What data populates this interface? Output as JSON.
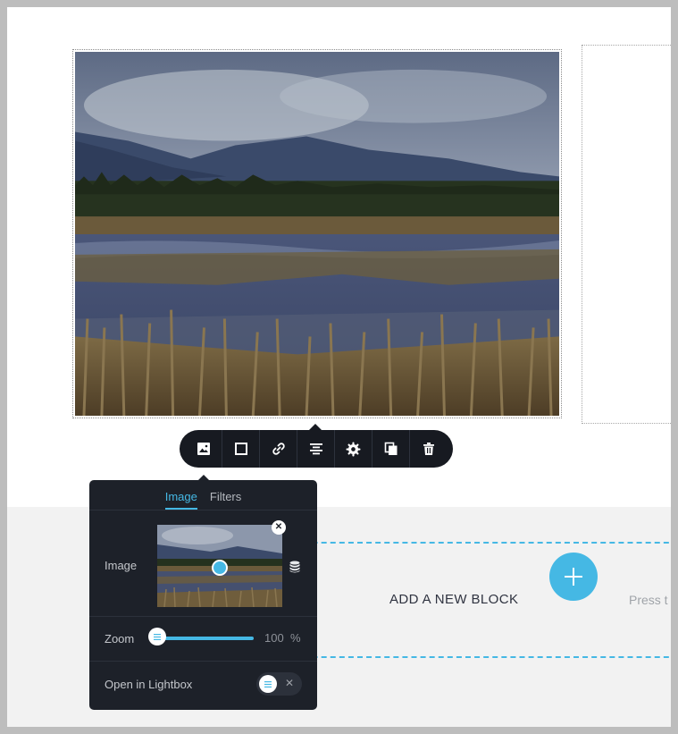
{
  "toolbar": {
    "items": [
      {
        "name": "image-tool",
        "icon": "image-icon"
      },
      {
        "name": "border-tool",
        "icon": "square-icon"
      },
      {
        "name": "link-tool",
        "icon": "link-icon"
      },
      {
        "name": "align-tool",
        "icon": "align-center-icon"
      },
      {
        "name": "settings-tool",
        "icon": "gear-icon"
      },
      {
        "name": "duplicate-tool",
        "icon": "copy-icon"
      },
      {
        "name": "delete-tool",
        "icon": "trash-icon"
      }
    ]
  },
  "panel": {
    "tabs": [
      {
        "label": "Image",
        "active": true
      },
      {
        "label": "Filters",
        "active": false
      }
    ],
    "image_row": {
      "label": "Image"
    },
    "zoom_row": {
      "label": "Zoom",
      "value": "100",
      "unit": "%"
    },
    "lightbox_row": {
      "label": "Open in Lightbox",
      "enabled": false,
      "off_glyph": "✕"
    }
  },
  "add_block": {
    "label": "ADD A NEW BLOCK",
    "button_glyph": "+",
    "hint": "Press t"
  },
  "colors": {
    "accent": "#45b8e4",
    "toolbar_bg": "#171a21",
    "panel_bg": "#1d2129",
    "lower_area": "#f2f2f2"
  }
}
